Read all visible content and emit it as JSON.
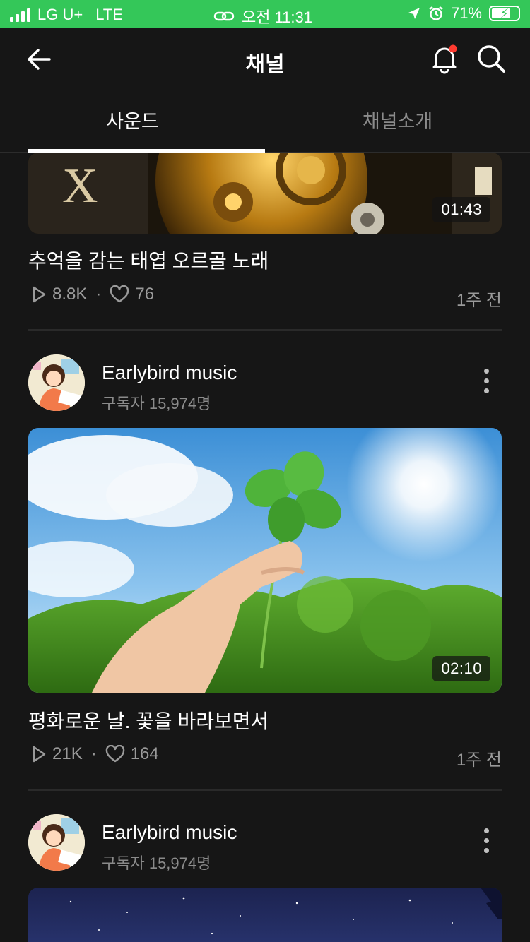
{
  "status_bar": {
    "carrier": "LG U+",
    "network": "LTE",
    "time": "오전 11:31",
    "battery": "71%",
    "battery_level": 0.71
  },
  "header": {
    "title": "채널"
  },
  "tabs": [
    {
      "label": "사운드",
      "active": true
    },
    {
      "label": "채널소개",
      "active": false
    }
  ],
  "items": [
    {
      "duration": "01:43",
      "title": "추억을 감는 태엽 오르골 노래",
      "plays": "8.8K",
      "likes": "76",
      "ago": "1주 전"
    },
    {
      "channel_name": "Earlybird music",
      "subscribers": "구독자 15,974명",
      "duration": "02:10",
      "title": "평화로운 날. 꽃을 바라보면서",
      "plays": "21K",
      "likes": "164",
      "ago": "1주 전"
    },
    {
      "channel_name": "Earlybird music",
      "subscribers": "구독자 15,974명"
    }
  ],
  "meta_separator": "·"
}
